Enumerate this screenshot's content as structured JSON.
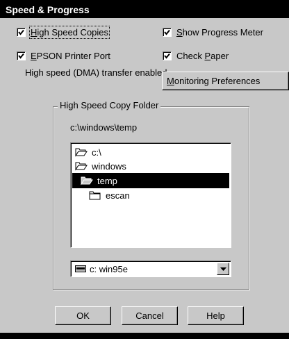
{
  "title": "Speed & Progress",
  "options": {
    "high_speed_copies": {
      "label": "High Speed Copies",
      "accel": "H",
      "checked": true
    },
    "show_progress_meter": {
      "label": "Show Progress Meter",
      "accel": "S",
      "checked": true
    },
    "epson_printer_port": {
      "label": "EPSON Printer Port",
      "accel": "E",
      "checked": true
    },
    "check_paper": {
      "label": "Check Paper",
      "accel": "P",
      "checked": true
    }
  },
  "status_text": "High speed (DMA) transfer enabled.",
  "monitoring_button": "Monitoring Preferences",
  "folder_group": {
    "title": "High Speed Copy Folder",
    "current_path": "c:\\windows\\temp",
    "tree": [
      {
        "name": "c:\\",
        "icon": "open-folder-icon",
        "selected": false
      },
      {
        "name": "windows",
        "icon": "open-folder-icon",
        "selected": false
      },
      {
        "name": "temp",
        "icon": "open-folder-icon",
        "selected": true
      },
      {
        "name": "escan",
        "icon": "closed-folder-icon",
        "selected": false
      }
    ],
    "drive": {
      "value": "c:  win95e",
      "icon": "drive-icon"
    }
  },
  "buttons": {
    "ok": "OK",
    "cancel": "Cancel",
    "help": "Help"
  }
}
